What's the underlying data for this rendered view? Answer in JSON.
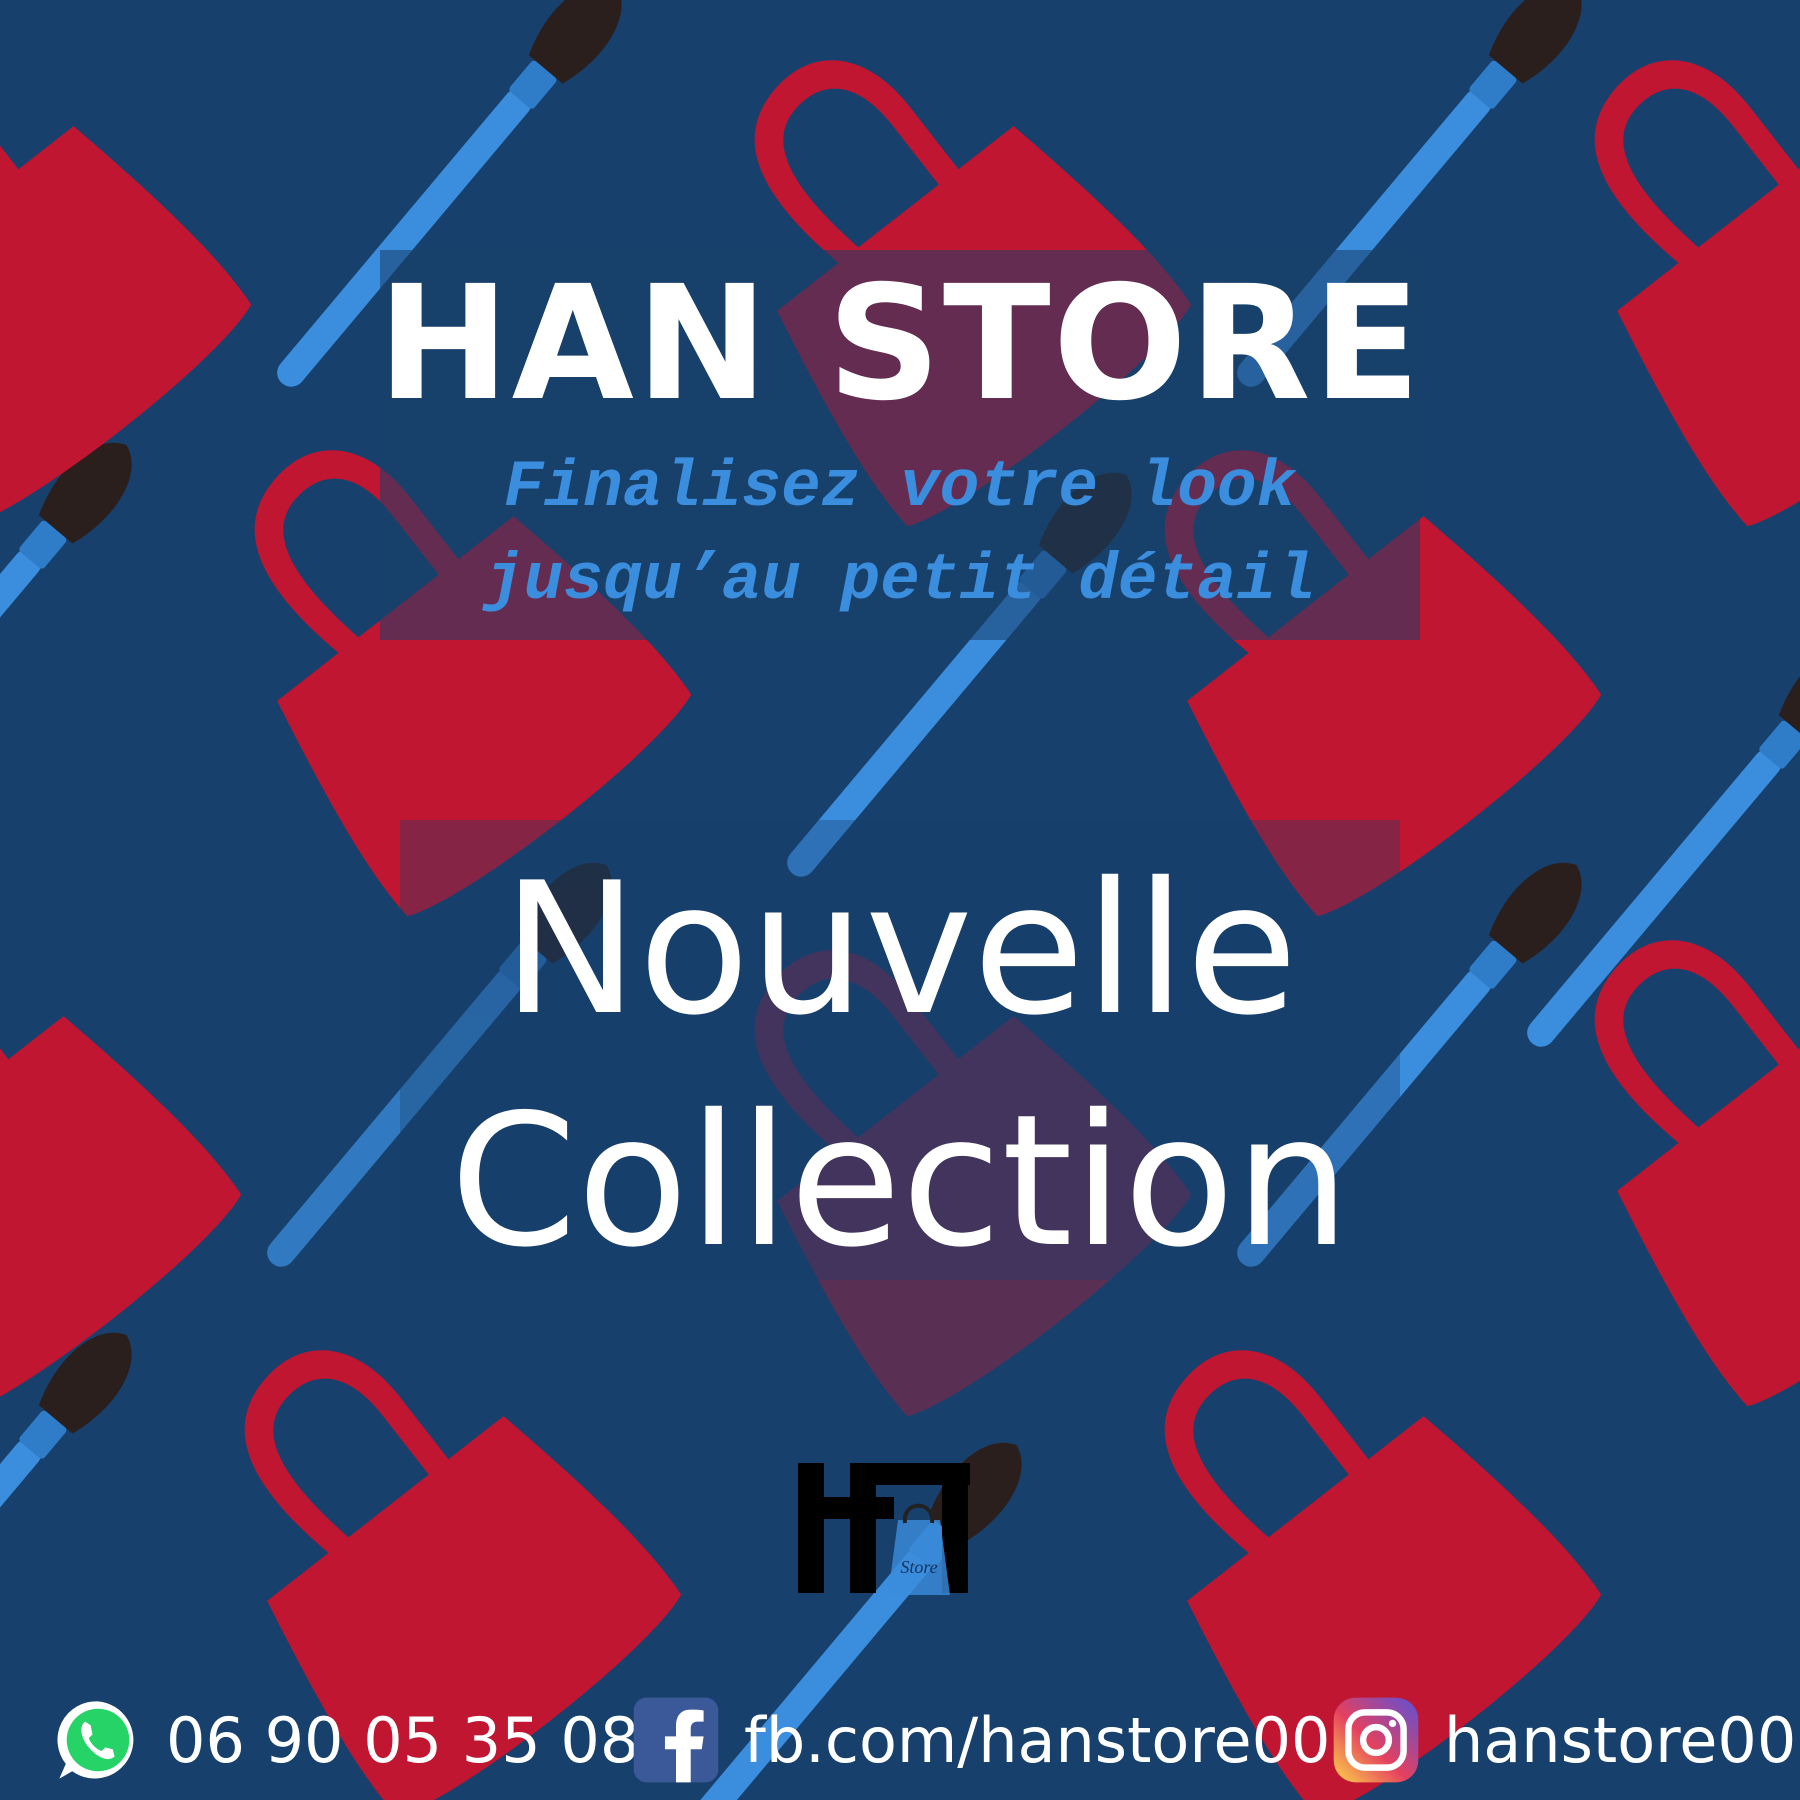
{
  "brand": {
    "title": "HAN STORE",
    "tagline_line1": "Finalisez votre look",
    "tagline_line2": "jusqu’au petit détail",
    "logo_caption": "Store"
  },
  "headline": {
    "line1": "Nouvelle",
    "line2": "Collection"
  },
  "contacts": [
    {
      "icon": "whatsapp-icon",
      "text": "06 90 05 35 08"
    },
    {
      "icon": "facebook-icon",
      "text": "fb.com/hanstore00"
    },
    {
      "icon": "instagram-icon",
      "text": "hanstore00"
    }
  ],
  "colors": {
    "background": "#17406c",
    "bag_red": "#c01631",
    "brush_blue": "#3b8ddd",
    "tagline_blue": "#3b8ddd",
    "text_white": "#ffffff"
  }
}
